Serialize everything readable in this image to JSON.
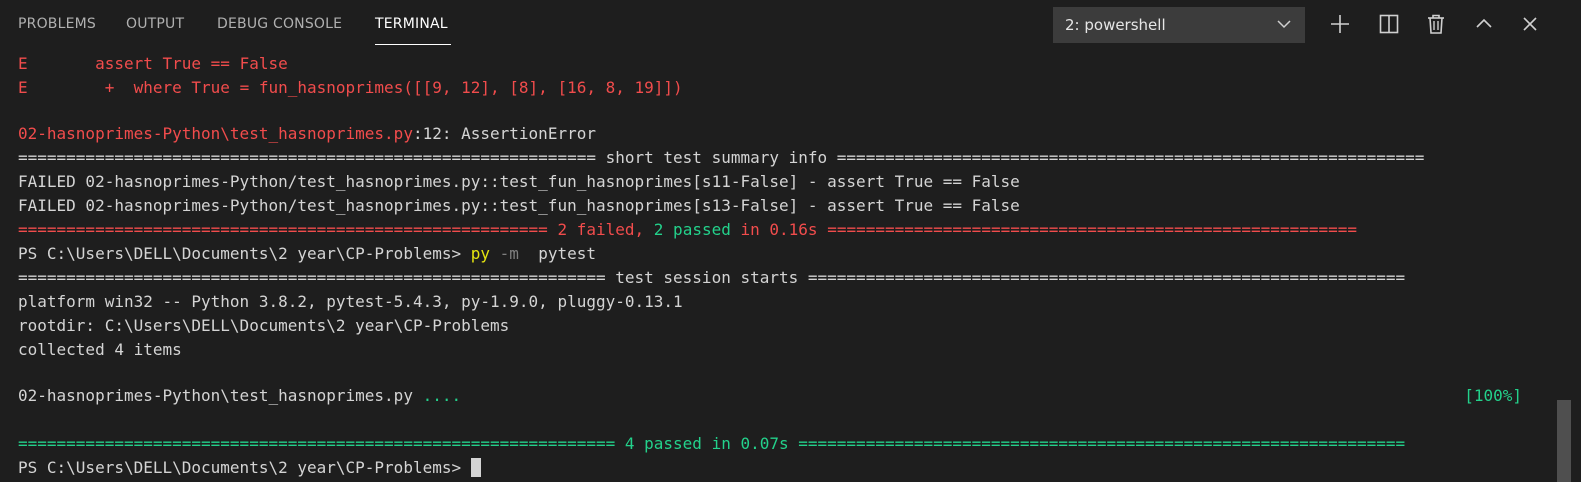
{
  "tabs": {
    "problems": "PROBLEMS",
    "output": "OUTPUT",
    "debug_console": "DEBUG CONSOLE",
    "terminal": "TERMINAL"
  },
  "terminal_select": {
    "selected": "2: powershell"
  },
  "toolbar": {
    "new_terminal_icon": "plus-icon",
    "split_icon": "split-icon",
    "kill_icon": "trash-icon",
    "maximize_icon": "chevron-up-icon",
    "close_icon": "close-icon"
  },
  "colors": {
    "error": "#f14c4c",
    "success": "#23d18b",
    "command": "#e5e510",
    "flag": "#7f7f7f",
    "text": "#d4d4d4",
    "background": "#1e1e1e"
  },
  "terminal": {
    "l1": {
      "prefix": "E",
      "text": "       assert True == False"
    },
    "l2": {
      "prefix": "E",
      "text": "        +  where True = fun_hasnoprimes([[9, 12], [8], [16, 8, 19]])"
    },
    "l3": {
      "path": "02-hasnoprimes-Python\\test_hasnoprimes.py",
      "rest": ":12: AssertionError"
    },
    "l4": "============================================================ short test summary info =============================================================",
    "l5": "FAILED 02-hasnoprimes-Python/test_hasnoprimes.py::test_fun_hasnoprimes[s11-False] - assert True == False",
    "l6": "FAILED 02-hasnoprimes-Python/test_hasnoprimes.py::test_fun_hasnoprimes[s13-False] - assert True == False",
    "l7": {
      "sep_left": "=======================================================",
      "failed": " 2 failed",
      "comma": ",",
      "passed": " 2 passed",
      "time": " in 0.16s ",
      "sep_right": "======================================================="
    },
    "l8": {
      "prompt": "PS C:\\Users\\DELL\\Documents\\2 year\\CP-Problems> ",
      "cmd": "py",
      "flag": " -m",
      "arg": "  pytest"
    },
    "l9": "============================================================= test session starts ==============================================================",
    "l10": "platform win32 -- Python 3.8.2, pytest-5.4.3, py-1.9.0, pluggy-0.13.1",
    "l11": "rootdir: C:\\Users\\DELL\\Documents\\2 year\\CP-Problems",
    "l12": "collected 4 items",
    "l13": {
      "file": "02-hasnoprimes-Python\\test_hasnoprimes.py",
      "dots": " ....",
      "pct": "[100%]"
    },
    "l14": "============================================================== 4 passed in 0.07s ===============================================================",
    "l15": {
      "prompt": "PS C:\\Users\\DELL\\Documents\\2 year\\CP-Problems>"
    }
  }
}
